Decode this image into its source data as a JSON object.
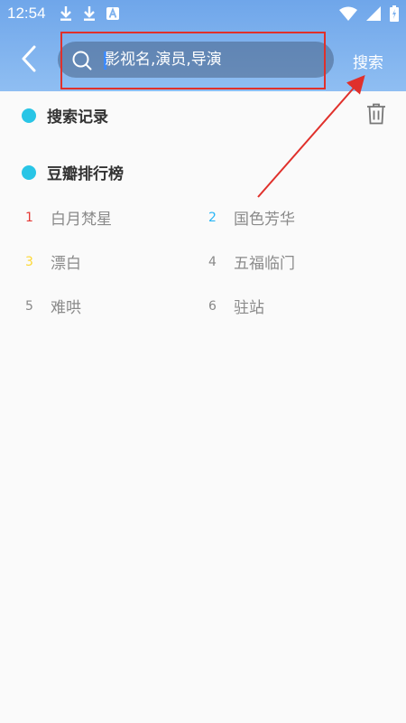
{
  "status_bar": {
    "time": "12:54",
    "left_icons": [
      "download-icon",
      "download-icon",
      "keyboard-a-icon"
    ],
    "right_icons": [
      "wifi-icon",
      "signal-icon",
      "battery-icon"
    ]
  },
  "header": {
    "search_placeholder": "影视名,演员,导演",
    "search_button": "搜索"
  },
  "history": {
    "title": "搜索记录"
  },
  "ranking": {
    "title": "豆瓣排行榜",
    "items": [
      {
        "rank": "1",
        "title": "白月梵星",
        "rank_color": "#e53935"
      },
      {
        "rank": "2",
        "title": "国色芳华",
        "rank_color": "#29b6f6"
      },
      {
        "rank": "3",
        "title": "漂白",
        "rank_color": "#fdd835"
      },
      {
        "rank": "4",
        "title": "五福临门",
        "rank_color": "#888888"
      },
      {
        "rank": "5",
        "title": "难哄",
        "rank_color": "#888888"
      },
      {
        "rank": "6",
        "title": "驻站",
        "rank_color": "#888888"
      }
    ]
  },
  "colors": {
    "accent": "#29c5e6",
    "annotation": "#e0302b"
  }
}
